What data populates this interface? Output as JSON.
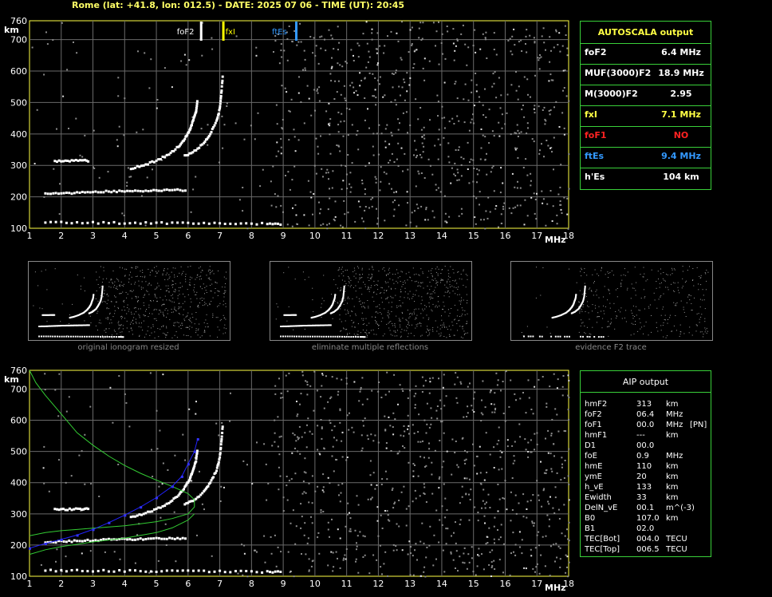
{
  "header": "Rome (lat: +41.8, lon: 012.5) - DATE: 2025 07 06 - TIME (UT): 20:45",
  "chart_data": [
    {
      "type": "scatter",
      "name": "autoscala-ionogram",
      "xlim": [
        1,
        18
      ],
      "ylim": [
        100,
        760
      ],
      "xticks": [
        1,
        2,
        3,
        4,
        5,
        6,
        7,
        8,
        9,
        10,
        11,
        12,
        13,
        14,
        15,
        16,
        17,
        18
      ],
      "yticks": [
        100,
        200,
        300,
        400,
        500,
        600,
        700,
        760
      ],
      "xunit": "MHz",
      "yunit": "km",
      "grid": true,
      "markers": [
        {
          "label": "foF2",
          "x": 6.4,
          "color": "#ffffff"
        },
        {
          "label": "fxI",
          "x": 7.1,
          "color": "#ffff00"
        },
        {
          "label": "ftEs",
          "x": 9.4,
          "color": "#3399ff"
        }
      ],
      "traces": [
        {
          "x": [
            4.2,
            4.6,
            5.0,
            5.4,
            5.7,
            5.9,
            6.05,
            6.15,
            6.25,
            6.3
          ],
          "y": [
            290,
            300,
            315,
            335,
            360,
            385,
            410,
            440,
            470,
            510
          ]
        },
        {
          "x": [
            5.9,
            6.2,
            6.5,
            6.7,
            6.9,
            7.0,
            7.05,
            7.1
          ],
          "y": [
            330,
            345,
            370,
            400,
            440,
            480,
            530,
            590
          ]
        },
        {
          "x": [
            1.5,
            2.0,
            2.5,
            3.0,
            3.5,
            4.0,
            4.5,
            5.0,
            5.5,
            6.0
          ],
          "y": [
            210,
            211,
            213,
            215,
            217,
            218,
            219,
            220,
            221,
            222
          ]
        },
        {
          "x": [
            1.5,
            2.5,
            3.5,
            4.5,
            5.5,
            6.5,
            7.5,
            8.5,
            9.0
          ],
          "y": [
            118,
            118,
            117,
            117,
            116,
            116,
            115,
            114,
            113
          ]
        },
        {
          "x": [
            1.8,
            2.2,
            2.6,
            2.9
          ],
          "y": [
            314,
            314,
            315,
            315
          ]
        }
      ]
    },
    {
      "type": "scatter",
      "name": "aip-ionogram",
      "xlim": [
        1,
        18
      ],
      "ylim": [
        100,
        760
      ],
      "xticks": [
        1,
        2,
        3,
        4,
        5,
        6,
        7,
        8,
        9,
        10,
        11,
        12,
        13,
        14,
        15,
        16,
        17,
        18
      ],
      "yticks": [
        100,
        200,
        300,
        400,
        500,
        600,
        700,
        760
      ],
      "xunit": "MHz",
      "yunit": "km",
      "grid": true,
      "traces": [
        {
          "x": [
            4.2,
            4.6,
            5.0,
            5.4,
            5.7,
            5.9,
            6.05,
            6.15,
            6.25,
            6.3
          ],
          "y": [
            290,
            300,
            315,
            335,
            360,
            385,
            410,
            440,
            470,
            510
          ]
        },
        {
          "x": [
            5.9,
            6.2,
            6.5,
            6.7,
            6.9,
            7.0,
            7.05,
            7.1
          ],
          "y": [
            330,
            345,
            370,
            400,
            440,
            480,
            530,
            590
          ]
        },
        {
          "x": [
            1.5,
            2.0,
            2.5,
            3.0,
            3.5,
            4.0,
            4.5,
            5.0,
            5.5,
            6.0
          ],
          "y": [
            210,
            211,
            213,
            215,
            217,
            218,
            219,
            220,
            221,
            222
          ]
        },
        {
          "x": [
            1.5,
            2.5,
            3.5,
            4.5,
            5.5,
            6.5,
            7.5,
            8.5,
            9.0
          ],
          "y": [
            118,
            118,
            117,
            117,
            116,
            116,
            115,
            114,
            113
          ]
        },
        {
          "x": [
            1.8,
            2.2,
            2.6,
            2.9
          ],
          "y": [
            314,
            314,
            315,
            315
          ]
        }
      ],
      "blue_profile": {
        "x": [
          1.0,
          1.5,
          2.0,
          2.5,
          3.0,
          3.5,
          4.0,
          4.5,
          5.0,
          5.5,
          5.8,
          6.0,
          6.2,
          6.3
        ],
        "y": [
          190,
          205,
          218,
          232,
          250,
          272,
          296,
          322,
          352,
          388,
          420,
          460,
          500,
          540
        ]
      },
      "green_profile": {
        "x": [
          1.0,
          1.2,
          1.5,
          2.0,
          2.5,
          3.0,
          3.5,
          4.0,
          4.5,
          5.0,
          5.5,
          6.0,
          6.2,
          6.2,
          6.0,
          5.5,
          5.0,
          4.5,
          4.0,
          3.5,
          3.0,
          2.5,
          2.0,
          1.5,
          1.0
        ],
        "y": [
          760,
          720,
          680,
          620,
          560,
          520,
          485,
          455,
          430,
          408,
          388,
          365,
          345,
          322,
          300,
          285,
          275,
          268,
          262,
          258,
          254,
          250,
          246,
          240,
          230
        ]
      },
      "green_lower": {
        "x": [
          1.0,
          1.5,
          2.0,
          3.0,
          4.0,
          5.0,
          5.5,
          6.0,
          6.2
        ],
        "y": [
          170,
          185,
          195,
          210,
          222,
          240,
          255,
          280,
          300
        ]
      }
    }
  ],
  "autoscala": {
    "title": "AUTOSCALA output",
    "rows": [
      {
        "label": "foF2",
        "value": "6.4 MHz",
        "color": "#ffffff"
      },
      {
        "label": "MUF(3000)F2",
        "value": "18.9 MHz",
        "color": "#ffffff"
      },
      {
        "label": "M(3000)F2",
        "value": "2.95",
        "color": "#ffffff"
      },
      {
        "label": "fxI",
        "value": "7.1 MHz",
        "color": "#ffff44"
      },
      {
        "label": "foF1",
        "value": "NO",
        "color": "#ff2222"
      },
      {
        "label": "ftEs",
        "value": "9.4 MHz",
        "color": "#3399ff"
      },
      {
        "label": "h'Es",
        "value": "104    km",
        "color": "#ffffff"
      }
    ]
  },
  "aip": {
    "title": "AIP output",
    "rows": [
      {
        "label": "hmF2",
        "value": "313",
        "unit": "km",
        "extra": ""
      },
      {
        "label": "foF2",
        "value": "06.4",
        "unit": "MHz",
        "extra": ""
      },
      {
        "label": "foF1",
        "value": "00.0",
        "unit": "MHz",
        "extra": "[PN]"
      },
      {
        "label": "hmF1",
        "value": "---",
        "unit": "km",
        "extra": ""
      },
      {
        "label": "D1",
        "value": "00.0",
        "unit": "",
        "extra": ""
      },
      {
        "label": "foE",
        "value": "0.9",
        "unit": "MHz",
        "extra": ""
      },
      {
        "label": "hmE",
        "value": "110",
        "unit": "km",
        "extra": ""
      },
      {
        "label": "ymE",
        "value": "20",
        "unit": "km",
        "extra": ""
      },
      {
        "label": "h_vE",
        "value": "133",
        "unit": "km",
        "extra": ""
      },
      {
        "label": "Ewidth",
        "value": "33",
        "unit": "km",
        "extra": ""
      },
      {
        "label": "DelN_vE",
        "value": "00.1",
        "unit": "m^(-3)",
        "extra": ""
      },
      {
        "label": "B0",
        "value": "107.0",
        "unit": "km",
        "extra": ""
      },
      {
        "label": "B1",
        "value": "02.0",
        "unit": "",
        "extra": ""
      },
      {
        "label": "TEC[Bot]",
        "value": "004.0",
        "unit": "TECU",
        "extra": ""
      },
      {
        "label": "TEC[Top]",
        "value": "006.5",
        "unit": "TECU",
        "extra": ""
      }
    ]
  },
  "thumbnails": [
    {
      "caption": "original ionogram resized",
      "trace": "full"
    },
    {
      "caption": "eliminate multiple reflections",
      "trace": "full"
    },
    {
      "caption": "evidence F2 trace",
      "trace": "f2"
    }
  ]
}
